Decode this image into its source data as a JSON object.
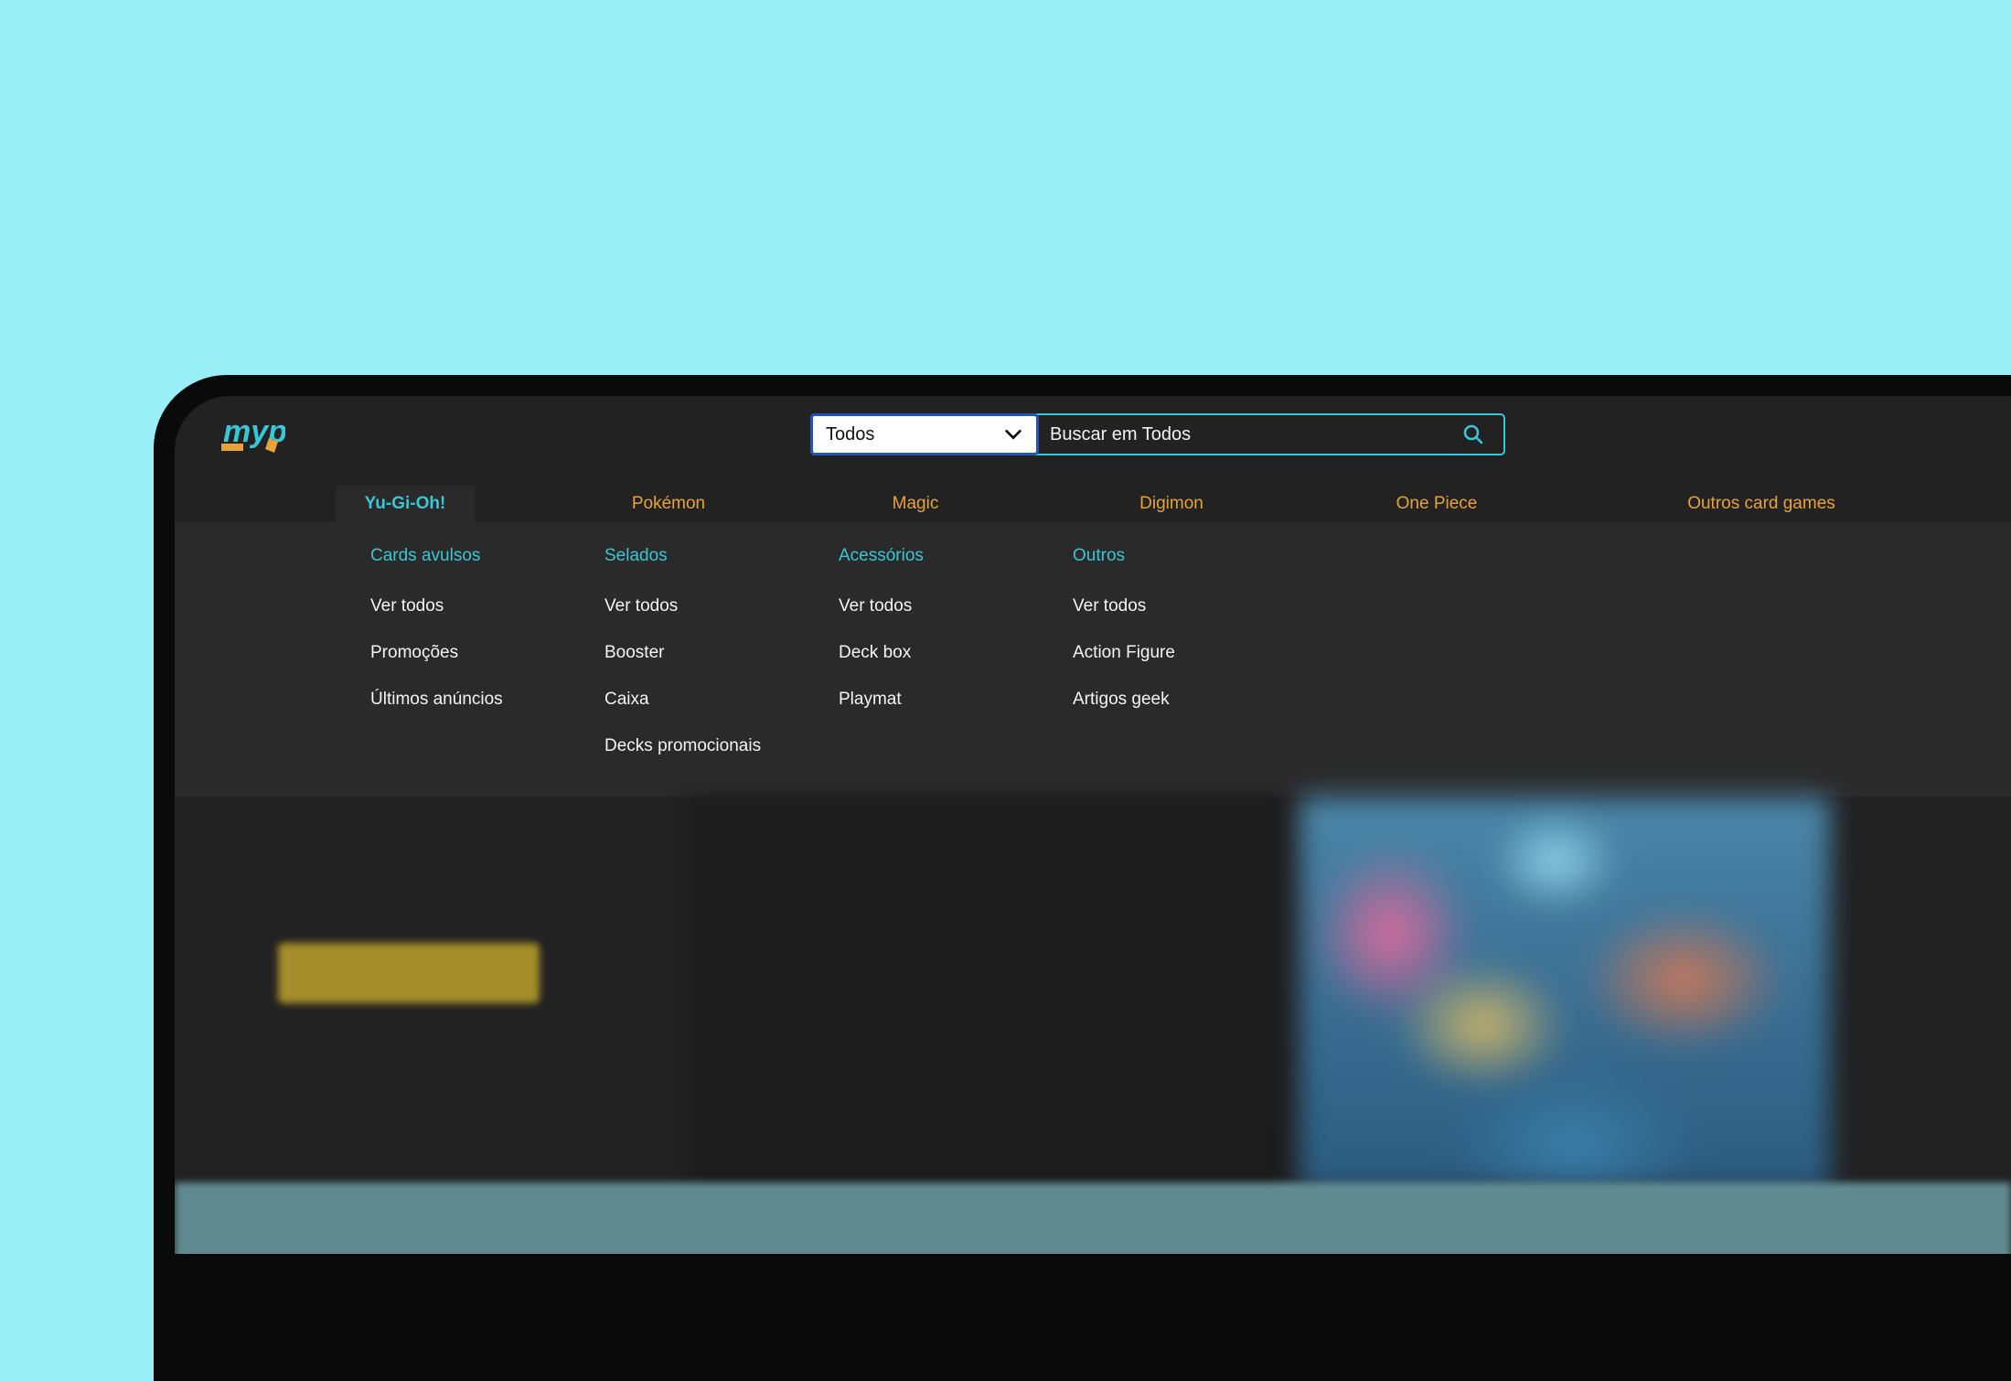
{
  "colors": {
    "background": "#98eff6",
    "screen": "#222222",
    "accent_teal": "#39c6d6",
    "accent_orange": "#e8a23a",
    "select_border": "#2353b6"
  },
  "header": {
    "logo_alt": "MYP Cards",
    "category_select_value": "Todos",
    "search_placeholder": "Buscar em Todos",
    "search_icon": "search-icon"
  },
  "nav": {
    "items": [
      {
        "label": "Yu-Gi-Oh!"
      },
      {
        "label": "Pokémon"
      },
      {
        "label": "Magic"
      },
      {
        "label": "Digimon"
      },
      {
        "label": "One Piece"
      },
      {
        "label": "Outros card games"
      }
    ],
    "active": "Yu-Gi-Oh!"
  },
  "dropdown": {
    "columns": [
      {
        "heading": "Cards avulsos",
        "links": [
          "Ver todos",
          "Promoções",
          "Últimos anúncios"
        ]
      },
      {
        "heading": "Selados",
        "links": [
          "Ver todos",
          "Booster",
          "Caixa",
          "Decks promocionais"
        ]
      },
      {
        "heading": "Acessórios",
        "links": [
          "Ver todos",
          "Deck box",
          "Playmat"
        ]
      },
      {
        "heading": "Outros",
        "links": [
          "Ver todos",
          "Action Figure",
          "Artigos geek"
        ]
      }
    ]
  }
}
